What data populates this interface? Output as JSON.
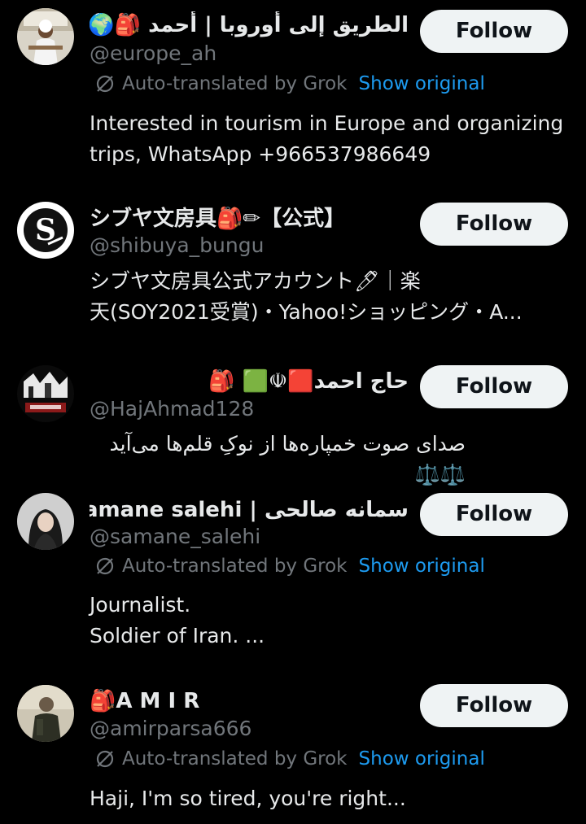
{
  "accent_color": "#1d9bf0",
  "follow_label": "Follow",
  "translation": {
    "label": "Auto-translated by Grok",
    "show_original": "Show original"
  },
  "users": [
    {
      "name": "الطريق إلى أوروبا | أحمد 🎒🌍",
      "handle": "@europe_ah",
      "verified": true,
      "bio": "Interested in tourism in Europe and organizing trips, WhatsApp +966537986649",
      "auto_translated": true
    },
    {
      "name": "シブヤ文房具🎒✏【公式】",
      "handle": "@shibuya_bungu",
      "bio": "シブヤ文房具公式アカウント🖊｜楽\n天(SOY2021受賞)・Yahoo!ショッピング・A...",
      "auto_translated": false
    },
    {
      "name": "حاج احمد🟥☫🟩 🎒",
      "handle": "@HajAhmad128",
      "bio": "صدای صوت خمپاره‌ها از نوکِ قلم‌ها می‌آید ⚖️⚖️",
      "auto_translated": false
    },
    {
      "name": "سمانه صالحی | samane salehi🎒",
      "handle": "@samane_salehi",
      "bio": "Journalist.\nSoldier of Iran.  ...",
      "auto_translated": true
    },
    {
      "name": "🎒A M I R",
      "handle": "@amirparsa666",
      "bio": "Haji, I'm so tired, you're right...",
      "auto_translated": true
    }
  ]
}
